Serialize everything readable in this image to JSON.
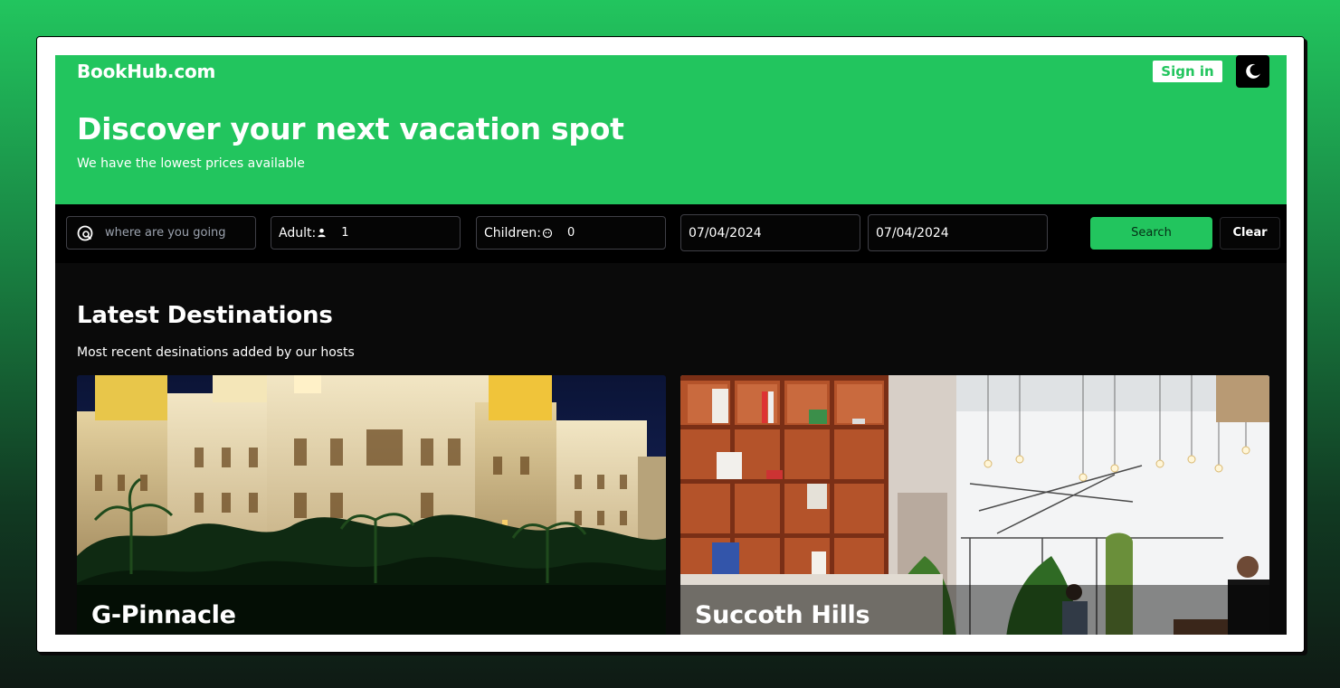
{
  "header": {
    "brand": "BookHub.com",
    "sign_in_label": "Sign in",
    "theme_toggle_icon": "moon-icon"
  },
  "hero": {
    "title": "Discover your next vacation spot",
    "subtitle": "We have the lowest prices available"
  },
  "search": {
    "destination_placeholder": "where are you going",
    "destination_value": "",
    "destination_icon": "location-search-icon",
    "adult_label": "Adult:",
    "adult_icon": "person-icon",
    "adult_value": "1",
    "children_label": "Children:",
    "children_icon": "child-icon",
    "children_value": "0",
    "check_in": "07/04/2024",
    "check_out": "07/04/2024",
    "search_label": "Search",
    "clear_label": "Clear"
  },
  "latest": {
    "title": "Latest Destinations",
    "subtitle": "Most recent desinations added by our hosts",
    "cards": [
      {
        "name": "G-Pinnacle"
      },
      {
        "name": "Succoth Hills"
      }
    ]
  },
  "colors": {
    "accent": "#22c55e",
    "background_dark": "#0a0a0a",
    "page_bg_top": "#22c55e",
    "page_bg_bottom": "#0f1a14"
  }
}
